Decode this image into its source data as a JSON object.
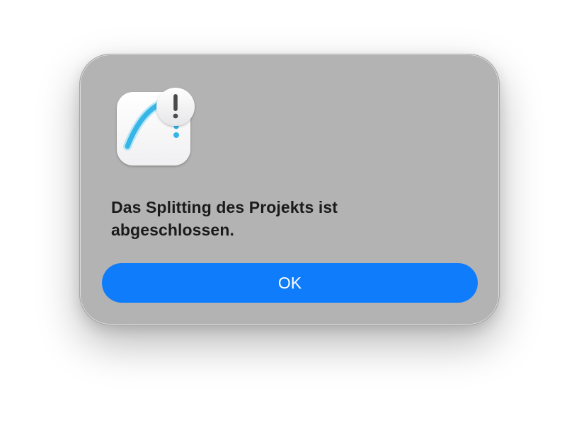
{
  "dialog": {
    "icon": "app-alert-icon",
    "message": "Das Splitting des Projekts ist abgeschlossen.",
    "ok_label": "OK"
  },
  "colors": {
    "dialog_background": "#b3b3b3",
    "button_accent": "#0f7cfb",
    "icon_curve": "#36b6e6",
    "text": "#1b1b1b"
  }
}
